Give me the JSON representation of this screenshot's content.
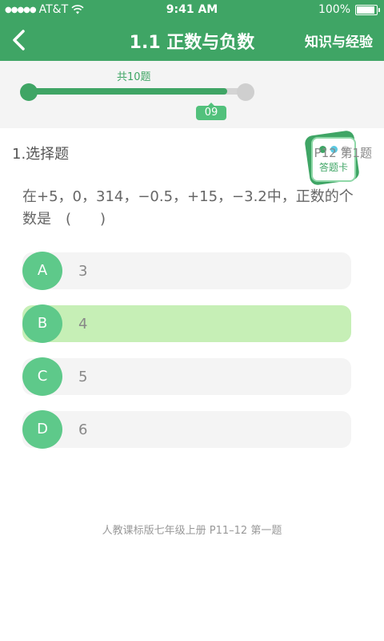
{
  "status_bar": {
    "carrier": "AT&T",
    "time": "9:41 AM",
    "battery": "100%"
  },
  "nav": {
    "title": "1.1 正数与负数",
    "right_link": "知识与经验"
  },
  "progress": {
    "total_label": "共10题",
    "current": "09",
    "current_index": 9,
    "total": 10
  },
  "answer_card": {
    "label": "答题卡",
    "dot_colors": [
      "#3fa565",
      "#5bc8e0",
      "#d8d8d8"
    ]
  },
  "question": {
    "type_label": "1.选择题",
    "reference": "P12 第1题",
    "text": "在+5，0，314，−0.5，+15，−3.2中，正数的个数是　(　　)"
  },
  "options": [
    {
      "letter": "A",
      "value": "3",
      "selected": false
    },
    {
      "letter": "B",
      "value": "4",
      "selected": true
    },
    {
      "letter": "C",
      "value": "5",
      "selected": false
    },
    {
      "letter": "D",
      "value": "6",
      "selected": false
    }
  ],
  "footer": {
    "note": "人教课标版七年级上册 P11–12 第一题"
  },
  "colors": {
    "brand_green": "#3fa565",
    "option_circle": "#5ec98a",
    "selected_bg": "#c6efb6"
  }
}
